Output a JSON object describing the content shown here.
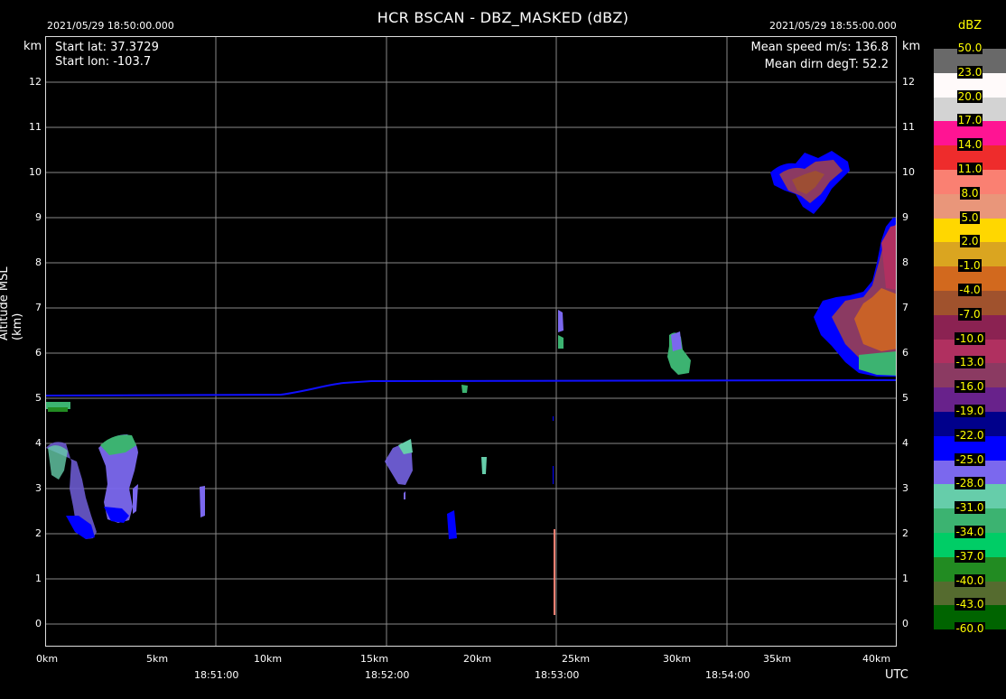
{
  "header": {
    "start_time": "2021/05/29 18:50:00.000",
    "end_time": "2021/05/29 18:55:00.000",
    "title": "HCR   BSCAN   -   DBZ_MASKED (dBZ)"
  },
  "axes": {
    "km_unit_left": "km",
    "km_unit_right": "km",
    "ylabel": "Altitude MSL (km)",
    "y_ticks": [
      "0",
      "1",
      "2",
      "3",
      "4",
      "5",
      "6",
      "7",
      "8",
      "9",
      "10",
      "11",
      "12"
    ],
    "x_dist_ticks": [
      "0km",
      "5km",
      "10km",
      "15km",
      "20km",
      "25km",
      "30km",
      "35km",
      "40km"
    ],
    "x_time_ticks": [
      "18:51:00",
      "18:52:00",
      "18:53:00",
      "18:54:00"
    ],
    "utc_label": "UTC"
  },
  "info": {
    "start_lat": "Start lat: 37.3729",
    "start_lon": "Start lon: -103.7",
    "mean_speed": "Mean speed m/s: 136.8",
    "mean_dirn": "Mean dirn degT: 52.2"
  },
  "colorbar": {
    "title": "dBZ",
    "bins": [
      {
        "label": "50.0",
        "color": "#696969"
      },
      {
        "label": "23.0",
        "color": "#fffafa"
      },
      {
        "label": "20.0",
        "color": "#d3d3d3"
      },
      {
        "label": "17.0",
        "color": "#ff1493"
      },
      {
        "label": "14.0",
        "color": "#ee2c2c"
      },
      {
        "label": "11.0",
        "color": "#fa8072"
      },
      {
        "label": "8.0",
        "color": "#e9967a"
      },
      {
        "label": "5.0",
        "color": "#ffd700"
      },
      {
        "label": "2.0",
        "color": "#daa520"
      },
      {
        "label": "-1.0",
        "color": "#d2691e"
      },
      {
        "label": "-4.0",
        "color": "#a0522d"
      },
      {
        "label": "-7.0",
        "color": "#8b2252"
      },
      {
        "label": "-10.0",
        "color": "#b03060"
      },
      {
        "label": "-13.0",
        "color": "#8b3a62"
      },
      {
        "label": "-16.0",
        "color": "#68228b"
      },
      {
        "label": "-19.0",
        "color": "#00008b"
      },
      {
        "label": "-22.0",
        "color": "#0000ff"
      },
      {
        "label": "-25.0",
        "color": "#7b68ee"
      },
      {
        "label": "-28.0",
        "color": "#66cdaa"
      },
      {
        "label": "-31.0",
        "color": "#3cb371"
      },
      {
        "label": "-34.0",
        "color": "#00cd66"
      },
      {
        "label": "-37.0",
        "color": "#228b22"
      },
      {
        "label": "-40.0",
        "color": "#556b2f"
      },
      {
        "label": "-43.0",
        "color": "#006400"
      },
      {
        "label": "-60.0",
        "color": ""
      }
    ]
  }
}
